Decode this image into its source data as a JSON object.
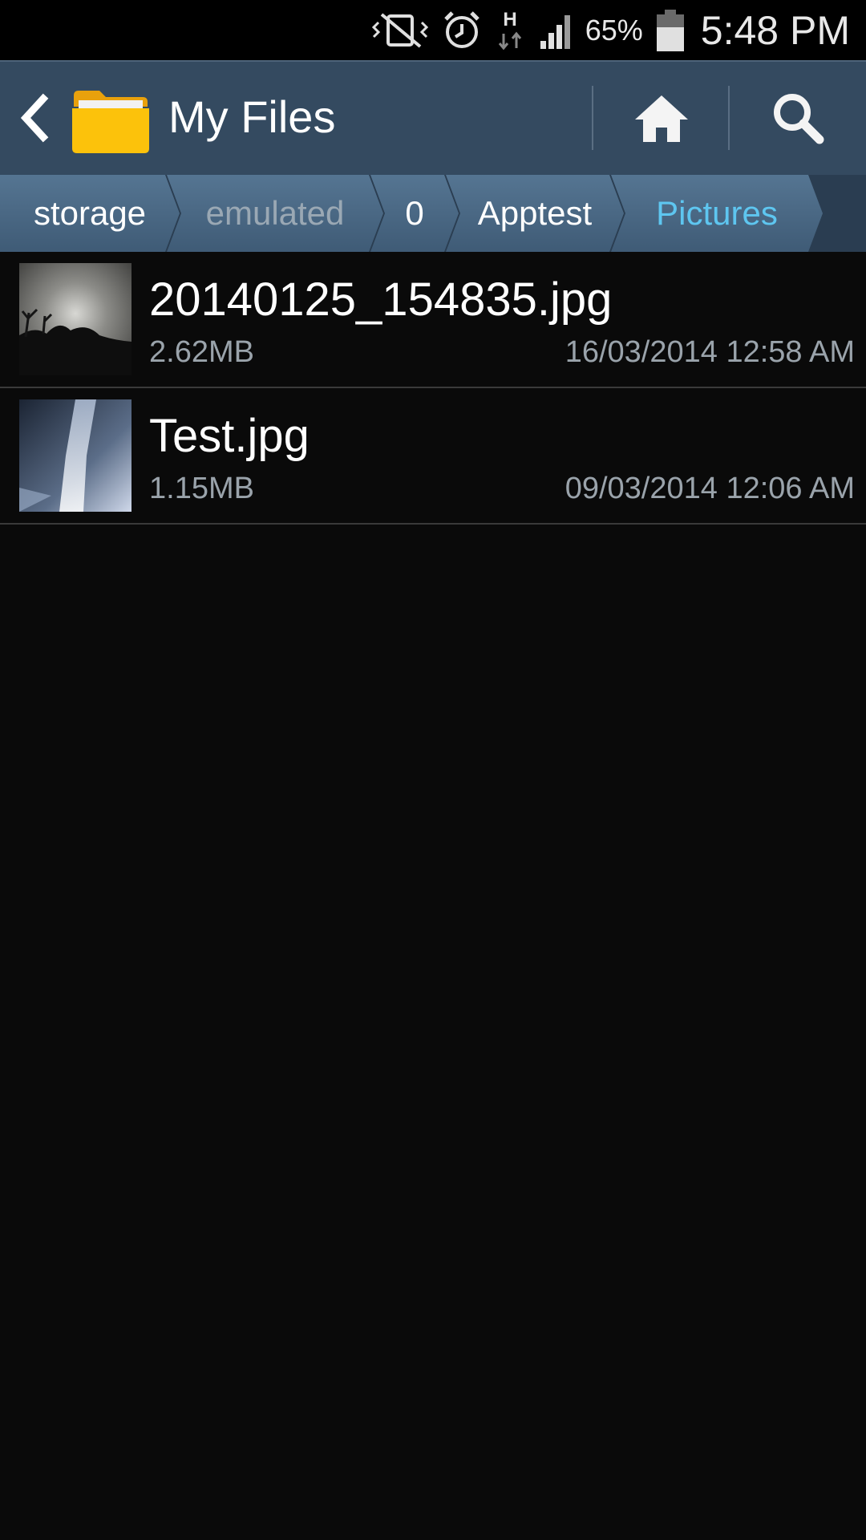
{
  "status_bar": {
    "battery_percent": "65%",
    "time": "5:48 PM",
    "icons": [
      "vibrate-mute-icon",
      "alarm-icon",
      "hspa-data-icon",
      "signal-icon",
      "battery-icon"
    ]
  },
  "action_bar": {
    "title": "My Files",
    "icons": [
      "back-icon",
      "folder-icon",
      "home-icon",
      "search-icon"
    ]
  },
  "breadcrumb": {
    "items": [
      {
        "label": "storage"
      },
      {
        "label": "emulated"
      },
      {
        "label": "0"
      },
      {
        "label": "Apptest"
      },
      {
        "label": "Pictures"
      }
    ]
  },
  "files": [
    {
      "name": "20140125_154835.jpg",
      "size": "2.62MB",
      "date": "16/03/2014 12:58 AM"
    },
    {
      "name": "Test.jpg",
      "size": "1.15MB",
      "date": "09/03/2014 12:06 AM"
    }
  ],
  "colors": {
    "action_bar": "#344a60",
    "breadcrumb_active": "#5ec6f0",
    "background": "#0a0a0a"
  }
}
